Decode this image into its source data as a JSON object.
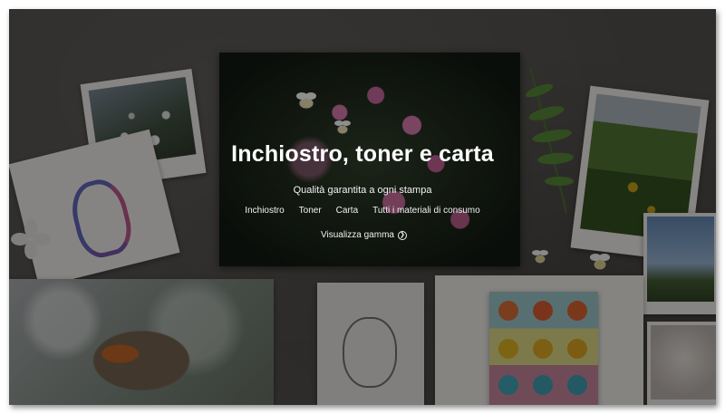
{
  "hero": {
    "title": "Inchiostro, toner e carta",
    "subtitle": "Qualità garantita a ogni stampa",
    "links": [
      "Inchiostro",
      "Toner",
      "Carta",
      "Tutti i materiali di consumo"
    ],
    "cta_label": "Visualizza gamma",
    "cta_icon": "chevron-right-circle-icon"
  },
  "colors": {
    "overlay": "#000000",
    "text": "#ffffff",
    "board": "#4d4a47"
  }
}
